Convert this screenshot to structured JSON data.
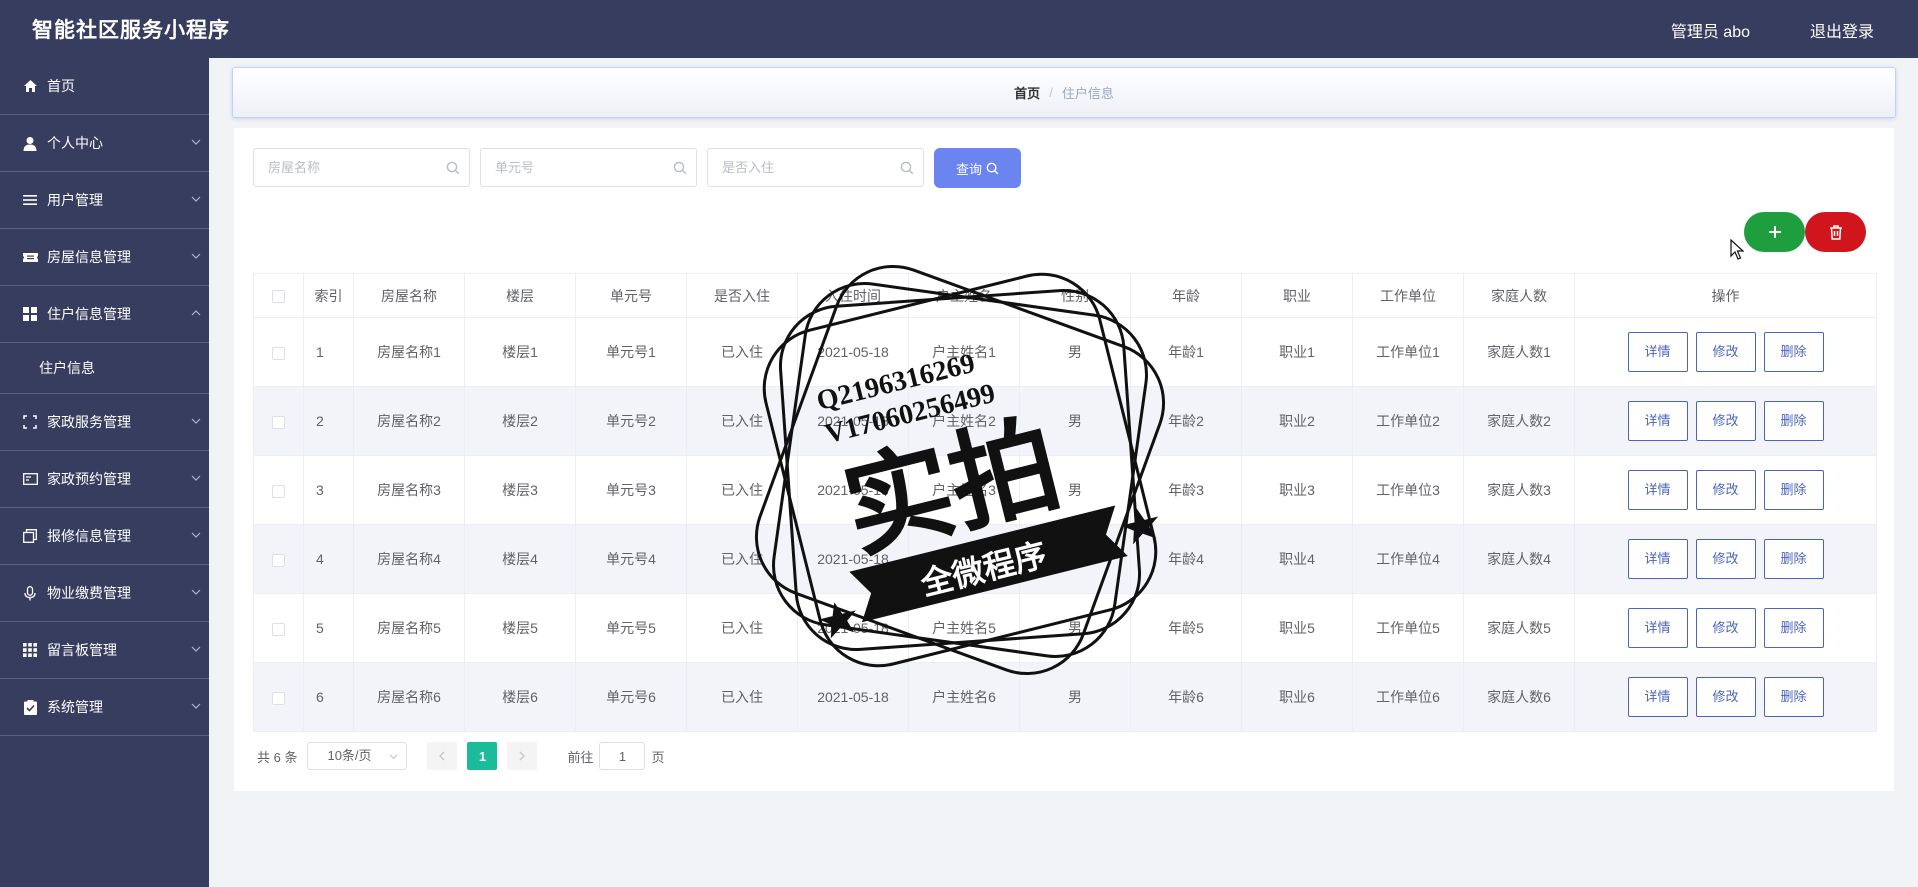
{
  "header": {
    "app_title": "智能社区服务小程序",
    "user": "管理员 abo",
    "logout": "退出登录"
  },
  "sidebar": {
    "items": [
      {
        "label": "首页",
        "icon": "home-icon"
      },
      {
        "label": "个人中心",
        "icon": "person-icon"
      },
      {
        "label": "用户管理",
        "icon": "list-icon"
      },
      {
        "label": "房屋信息管理",
        "icon": "ticket-icon"
      },
      {
        "label": "住户信息管理",
        "icon": "grid-icon"
      },
      {
        "label": "家政服务管理",
        "icon": "frame-icon"
      },
      {
        "label": "家政预约管理",
        "icon": "card-icon"
      },
      {
        "label": "报修信息管理",
        "icon": "copy-icon"
      },
      {
        "label": "物业缴费管理",
        "icon": "microphone-icon"
      },
      {
        "label": "留言板管理",
        "icon": "apps-icon"
      },
      {
        "label": "系统管理",
        "icon": "clipboard-check-icon"
      }
    ],
    "submenu": {
      "label": "住户信息"
    }
  },
  "breadcrumb": {
    "home": "首页",
    "separator": "/",
    "current": "住户信息"
  },
  "search": {
    "house_placeholder": "房屋名称",
    "unit_placeholder": "单元号",
    "checkin_placeholder": "是否入住",
    "query_label": "查询"
  },
  "table": {
    "columns": [
      "索引",
      "房屋名称",
      "楼层",
      "单元号",
      "是否入住",
      "入住时间",
      "户主姓名",
      "性别",
      "年龄",
      "职业",
      "工作单位",
      "家庭人数",
      "操作"
    ],
    "rows": [
      {
        "index": "1",
        "house": "房屋名称1",
        "floor": "楼层1",
        "unit": "单元号1",
        "checkin": "已入住",
        "date": "2021-05-18",
        "owner": "户主姓名1",
        "gender": "男",
        "age": "年龄1",
        "job": "职业1",
        "company": "工作单位1",
        "family": "家庭人数1"
      },
      {
        "index": "2",
        "house": "房屋名称2",
        "floor": "楼层2",
        "unit": "单元号2",
        "checkin": "已入住",
        "date": "2021-05-18",
        "owner": "户主姓名2",
        "gender": "男",
        "age": "年龄2",
        "job": "职业2",
        "company": "工作单位2",
        "family": "家庭人数2"
      },
      {
        "index": "3",
        "house": "房屋名称3",
        "floor": "楼层3",
        "unit": "单元号3",
        "checkin": "已入住",
        "date": "2021-05-18",
        "owner": "户主姓名3",
        "gender": "男",
        "age": "年龄3",
        "job": "职业3",
        "company": "工作单位3",
        "family": "家庭人数3"
      },
      {
        "index": "4",
        "house": "房屋名称4",
        "floor": "楼层4",
        "unit": "单元号4",
        "checkin": "已入住",
        "date": "2021-05-18",
        "owner": "户主姓名4",
        "gender": "男",
        "age": "年龄4",
        "job": "职业4",
        "company": "工作单位4",
        "family": "家庭人数4"
      },
      {
        "index": "5",
        "house": "房屋名称5",
        "floor": "楼层5",
        "unit": "单元号5",
        "checkin": "已入住",
        "date": "2021-05-18",
        "owner": "户主姓名5",
        "gender": "男",
        "age": "年龄5",
        "job": "职业5",
        "company": "工作单位5",
        "family": "家庭人数5"
      },
      {
        "index": "6",
        "house": "房屋名称6",
        "floor": "楼层6",
        "unit": "单元号6",
        "checkin": "已入住",
        "date": "2021-05-18",
        "owner": "户主姓名6",
        "gender": "男",
        "age": "年龄6",
        "job": "职业6",
        "company": "工作单位6",
        "family": "家庭人数6"
      }
    ],
    "actions": {
      "detail": "详情",
      "edit": "修改",
      "delete": "删除"
    }
  },
  "pagination": {
    "total": "共 6 条",
    "page_size": "10条/页",
    "current_page": "1",
    "goto_label": "前往",
    "goto_value": "1",
    "page_suffix": "页"
  },
  "watermark": {
    "line1": "Q2196316269",
    "line2": "V17060256499",
    "main": "实拍",
    "banner": "全微程序"
  },
  "colors": {
    "topbar": "#373d5e",
    "sidebar": "#373d5e",
    "query_button": "#6b84f0",
    "add_button": "#1e9e3f",
    "delete_button": "#d0161c",
    "pager_active": "#1bbc9b",
    "action_border": "#4a65b8"
  }
}
